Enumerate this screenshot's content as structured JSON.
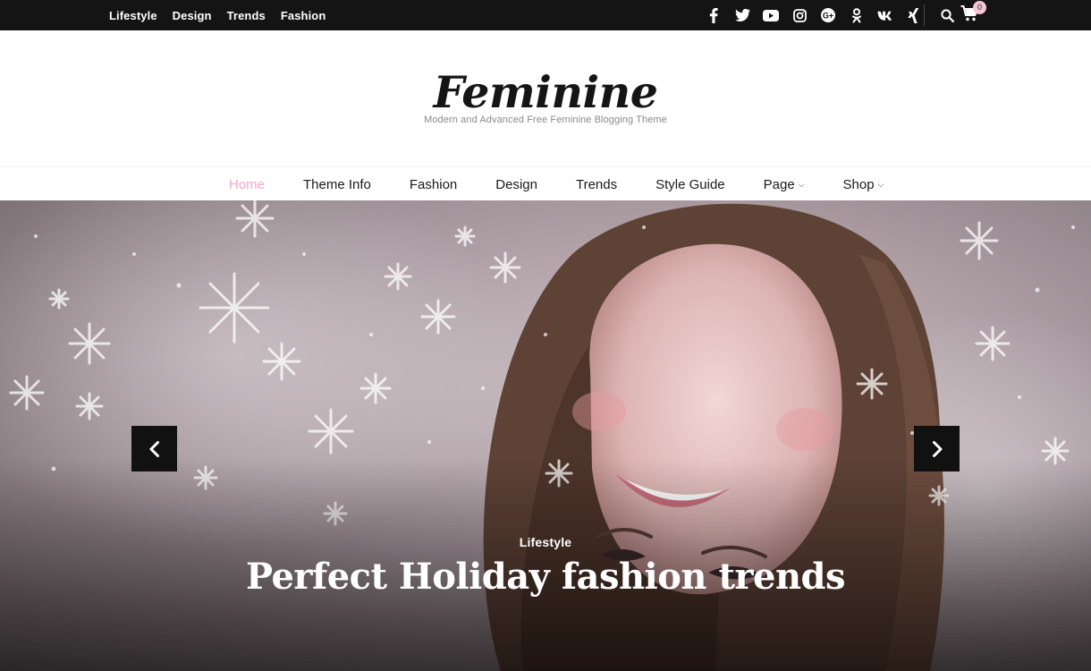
{
  "top_nav": [
    "Lifestyle",
    "Design",
    "Trends",
    "Fashion"
  ],
  "social_icons": [
    "facebook-icon",
    "twitter-icon",
    "youtube-icon",
    "instagram-icon",
    "google-plus-icon",
    "odnoklassniki-icon",
    "vk-icon",
    "xing-icon"
  ],
  "cart": {
    "count": "0"
  },
  "site": {
    "title": "Feminine",
    "tagline": "Modern and Advanced Free Feminine Blogging Theme"
  },
  "main_nav": [
    {
      "label": "Home",
      "active": true
    },
    {
      "label": "Theme Info"
    },
    {
      "label": "Fashion"
    },
    {
      "label": "Design"
    },
    {
      "label": "Trends"
    },
    {
      "label": "Style Guide"
    },
    {
      "label": "Page",
      "dropdown": true
    },
    {
      "label": "Shop",
      "dropdown": true
    }
  ],
  "hero": {
    "category": "Lifestyle",
    "title": "Perfect Holiday fashion trends"
  },
  "colors": {
    "topbar": "#141414",
    "accent_pink": "#f4a8c8",
    "arrow_bg": "#111111"
  }
}
